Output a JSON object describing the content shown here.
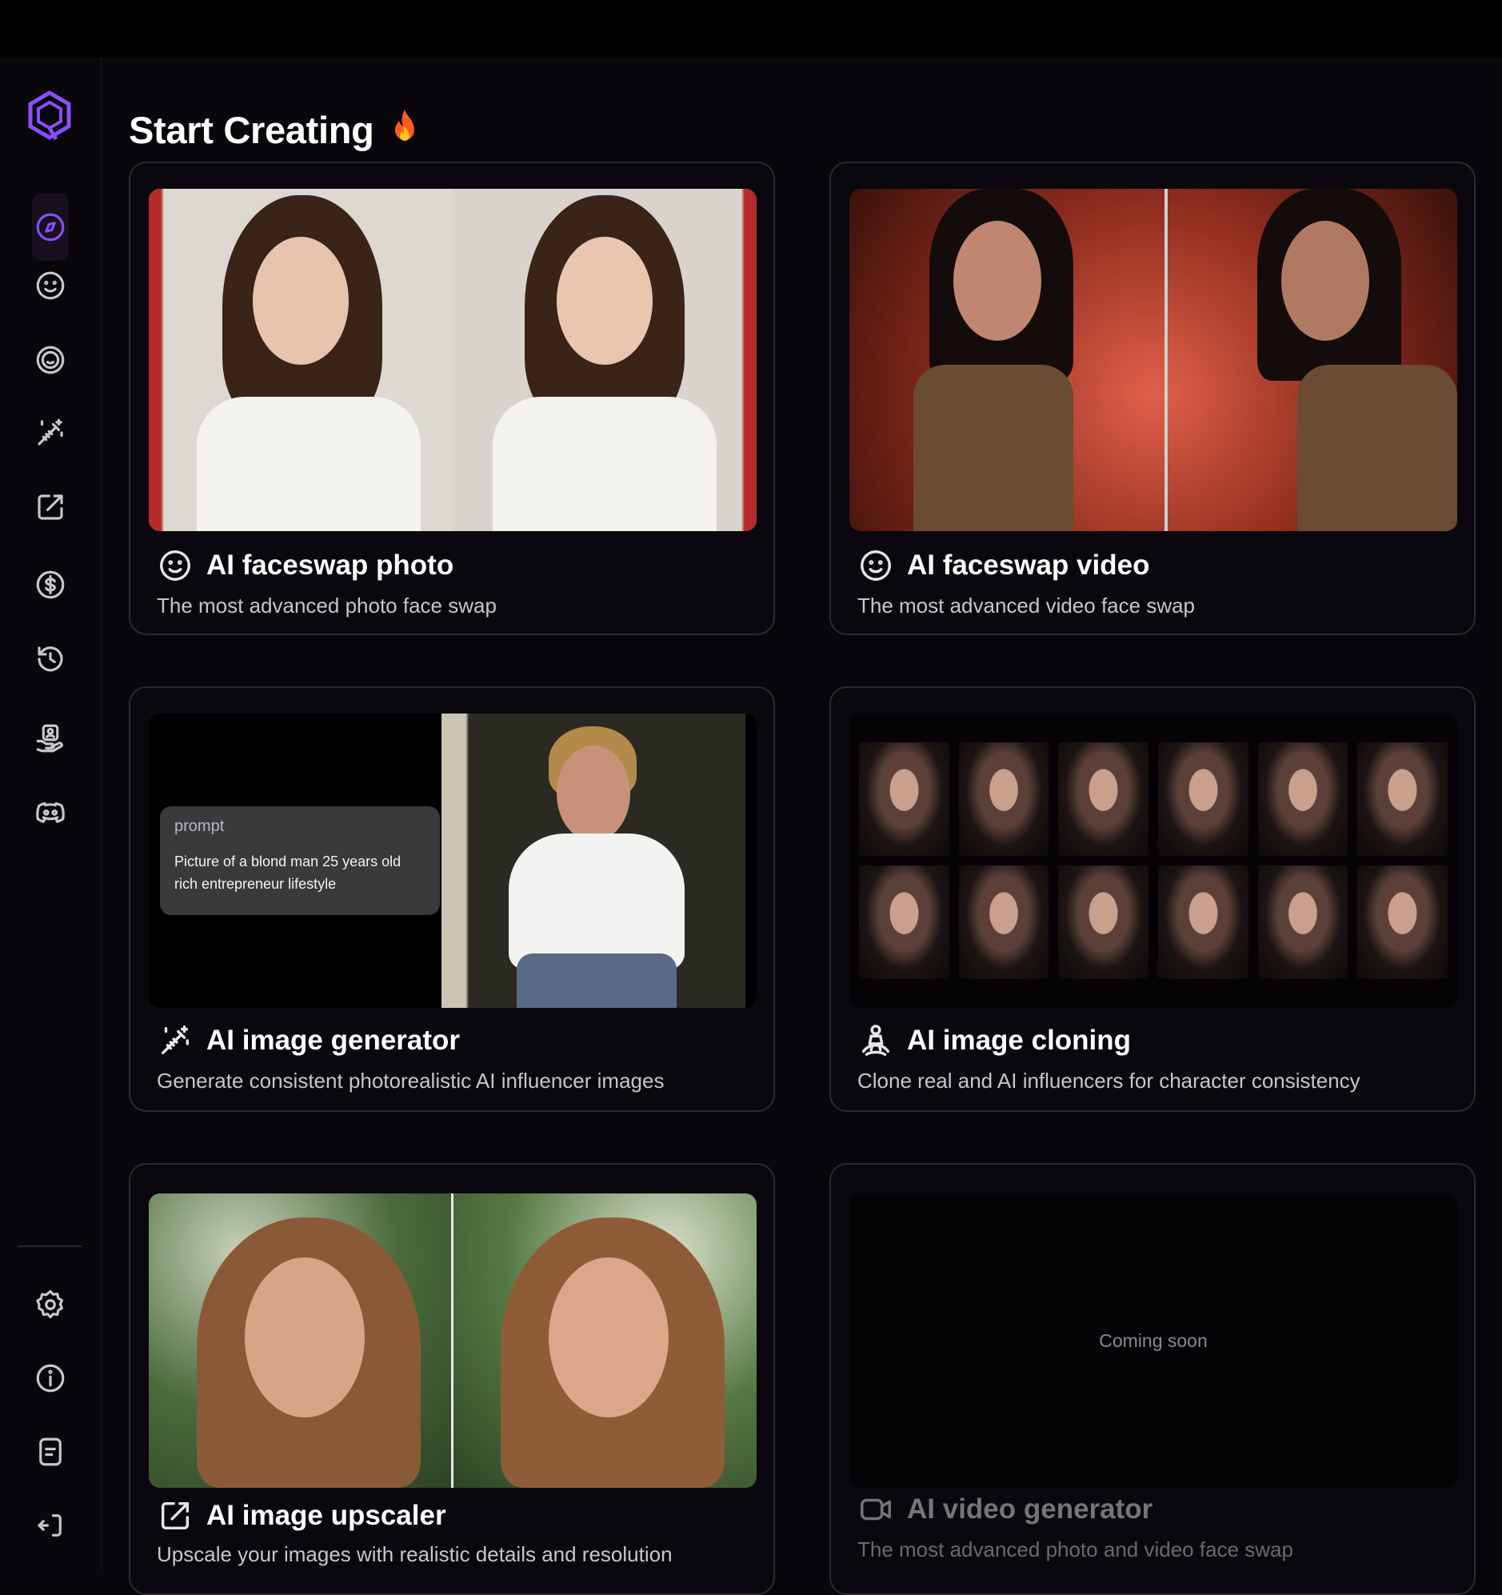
{
  "page": {
    "title": "Start Creating",
    "title_emoji": "fire-icon"
  },
  "sidebar": {
    "logo": "app-logo",
    "items": [
      {
        "name": "explore",
        "icon": "compass-icon",
        "active": true
      },
      {
        "name": "faceswap",
        "icon": "smile-icon"
      },
      {
        "name": "face-video",
        "icon": "smile-circle-icon"
      },
      {
        "name": "image-generator",
        "icon": "magic-wand-icon"
      },
      {
        "name": "upscaler",
        "icon": "external-link-icon"
      },
      {
        "name": "pricing",
        "icon": "dollar-icon"
      },
      {
        "name": "history",
        "icon": "history-icon"
      },
      {
        "name": "affiliate",
        "icon": "hand-user-icon"
      },
      {
        "name": "discord",
        "icon": "discord-icon"
      }
    ],
    "bottom_items": [
      {
        "name": "settings",
        "icon": "gear-icon"
      },
      {
        "name": "info",
        "icon": "info-icon"
      },
      {
        "name": "docs",
        "icon": "document-icon"
      },
      {
        "name": "logout",
        "icon": "logout-icon"
      }
    ]
  },
  "cards": [
    {
      "title": "AI faceswap photo",
      "desc": "The most advanced photo face swap",
      "icon": "smile-icon"
    },
    {
      "title": "AI faceswap video",
      "desc": "The most advanced video face swap",
      "icon": "smile-icon"
    },
    {
      "title": "AI image generator",
      "desc": "Generate consistent photorealistic AI influencer images",
      "icon": "magic-wand-icon",
      "prompt_label": "prompt",
      "prompt_text": "Picture of a blond man 25 years old rich entrepreneur lifestyle"
    },
    {
      "title": "AI image cloning",
      "desc": "Clone real and AI influencers for character consistency",
      "icon": "person-clone-icon"
    },
    {
      "title": "AI image upscaler",
      "desc": "Upscale your images with realistic details and resolution",
      "icon": "external-link-icon"
    },
    {
      "title": "AI video generator",
      "desc": "The most advanced photo and video face swap",
      "icon": "video-camera-icon",
      "placeholder": "Coming soon",
      "disabled": true
    }
  ],
  "colors": {
    "accent": "#8b4dff",
    "background": "#09060c",
    "card_border": "#2d2833"
  }
}
